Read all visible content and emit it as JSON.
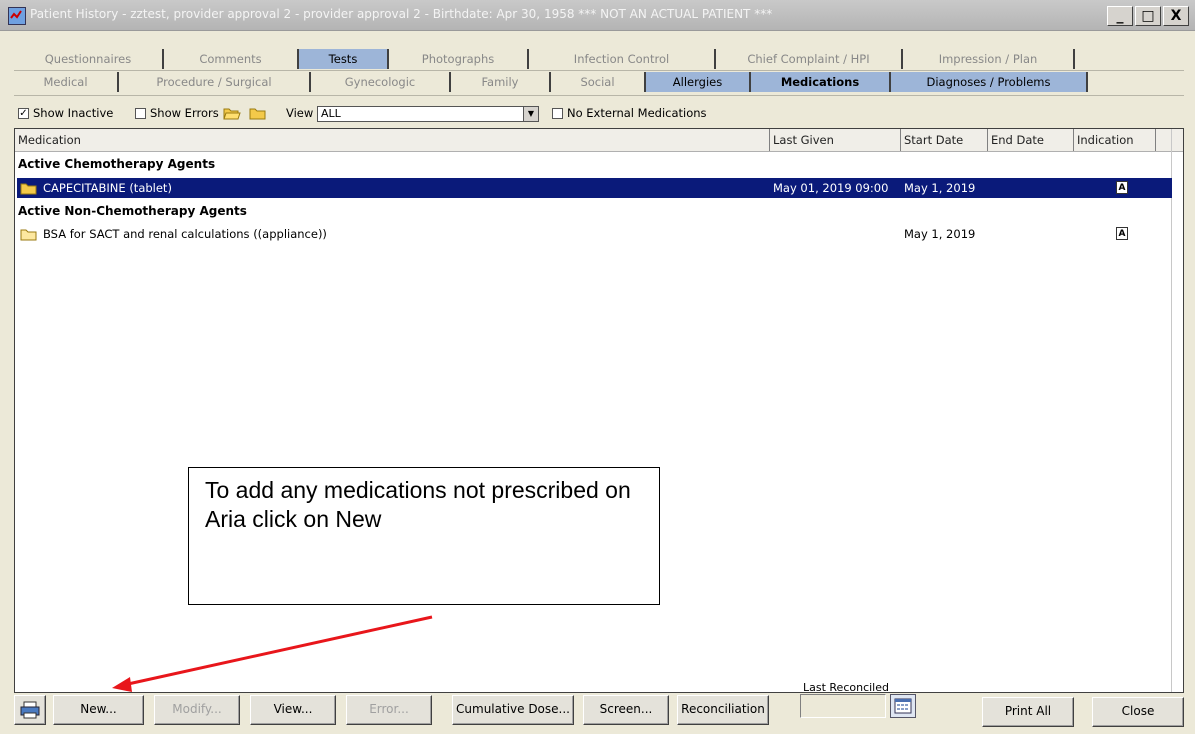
{
  "window": {
    "title": "Patient History - zztest, provider approval 2 - provider approval 2 - Birthdate: Apr 30, 1958 *** NOT AN ACTUAL PATIENT ***",
    "min": "_",
    "max": "□",
    "close": "X"
  },
  "tabs_top": [
    "Questionnaires",
    "Comments",
    "Tests",
    "Photographs",
    "Infection Control",
    "Chief Complaint / HPI",
    "Impression / Plan"
  ],
  "tabs_bottom": [
    "Medical",
    "Procedure / Surgical",
    "Gynecologic",
    "Family",
    "Social",
    "Allergies",
    "Medications",
    "Diagnoses / Problems"
  ],
  "toolbar": {
    "show_inactive": "Show Inactive",
    "show_errors": "Show Errors",
    "view_label": "View",
    "view_value": "ALL",
    "no_external": "No External Medications",
    "check_mark": "✓"
  },
  "grid": {
    "headers": [
      "Medication",
      "Last Given",
      "Start Date",
      "End Date",
      "Indication"
    ],
    "group1": "Active Chemotherapy Agents",
    "group2": "Active Non-Chemotherapy Agents",
    "rows": [
      {
        "name": "CAPECITABINE (tablet)",
        "last_given": "May 01, 2019 09:00",
        "start": "May 1, 2019",
        "end": "",
        "indication": "A"
      },
      {
        "name": "BSA for SACT and renal calculations ((appliance))",
        "last_given": "",
        "start": "May 1, 2019",
        "end": "",
        "indication": "A"
      }
    ]
  },
  "callout": "To add any medications not prescribed on Aria click on New",
  "buttons": {
    "new": "New...",
    "modify": "Modify...",
    "view": "View...",
    "error": "Error...",
    "cumulative": "Cumulative Dose...",
    "screen": "Screen...",
    "reconciliation": "Reconciliation",
    "last_reconciled": "Last Reconciled",
    "print_all": "Print All",
    "close": "Close"
  },
  "colors": {
    "selected_row": "#0a1a7a",
    "selected_tab": "#9db5d8",
    "arrow": "#e8161b"
  }
}
